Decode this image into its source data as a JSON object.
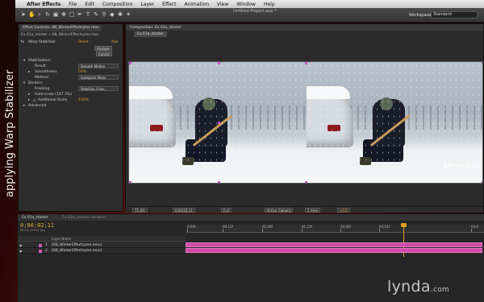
{
  "menubar": {
    "app_name": "After Effects",
    "items": [
      "File",
      "Edit",
      "Composition",
      "Layer",
      "Effect",
      "Animation",
      "View",
      "Window",
      "Help"
    ]
  },
  "document_title": "Untitled Project.aep *",
  "workspace": {
    "label": "Workspace:",
    "value": "Standard"
  },
  "side_title": "applying Warp Stabilizer",
  "effect_controls": {
    "tab": "Effect Controls: AB_WinterEffectsyles.mov",
    "breadcrumb": "Ex.01a_starter • AB_WinterEffectsyles.mov",
    "effect_name": "Warp Stabilizer",
    "reset_label": "Reset",
    "about_label": "Abo",
    "analyze_label": "Analyze",
    "cancel_label": "Cancel",
    "rows": [
      {
        "label": "Stabilization"
      },
      {
        "label": "Result",
        "value": "Smooth Motion"
      },
      {
        "label": "Smoothness",
        "value": "50%"
      },
      {
        "label": "Method",
        "value": "Subspace Warp"
      },
      {
        "label": "Borders"
      },
      {
        "label": "Framing",
        "value": "Stabilize, Crop..."
      },
      {
        "label": "Auto-scale (107.3%)"
      },
      {
        "label": "Additional Scale",
        "value": "100%"
      },
      {
        "label": "Advanced"
      }
    ]
  },
  "composition": {
    "tab": "Composition: Ex.01a_starter",
    "subtab": "Ex.01a_starter",
    "watermark": "ARTBEATS",
    "watermark_sub": "ROYALTY FREE STOCK",
    "bottom": {
      "zoom": "71.4%",
      "timecode": "0;00;02;11",
      "resolution": "Full",
      "camera": "Active Camera",
      "views": "1 View",
      "exposure": "+0.0"
    }
  },
  "timeline": {
    "tabs": [
      "Ex.01a_starter",
      "Ex.01b_motion variation"
    ],
    "current_time": "0;00;02;11",
    "fps": "00071 (29.97 fps)",
    "ruler_ticks": [
      "0;00f",
      "00;12f",
      "01;00f",
      "01;12f",
      "02;00f",
      "02;12f",
      "03;0"
    ],
    "column_header": "Layer Name",
    "layers": [
      {
        "num": "1",
        "name": "[AB_WinterEffectsyles.mov]"
      },
      {
        "num": "2",
        "name": "[AB_WinterEffectsyles.mov]"
      }
    ]
  },
  "branding": {
    "logo": "lynda",
    "suffix": ".com"
  },
  "colors": {
    "layer_bar": "#d14aa8",
    "cti": "#e0a020",
    "value_orange": "#e0a030"
  }
}
